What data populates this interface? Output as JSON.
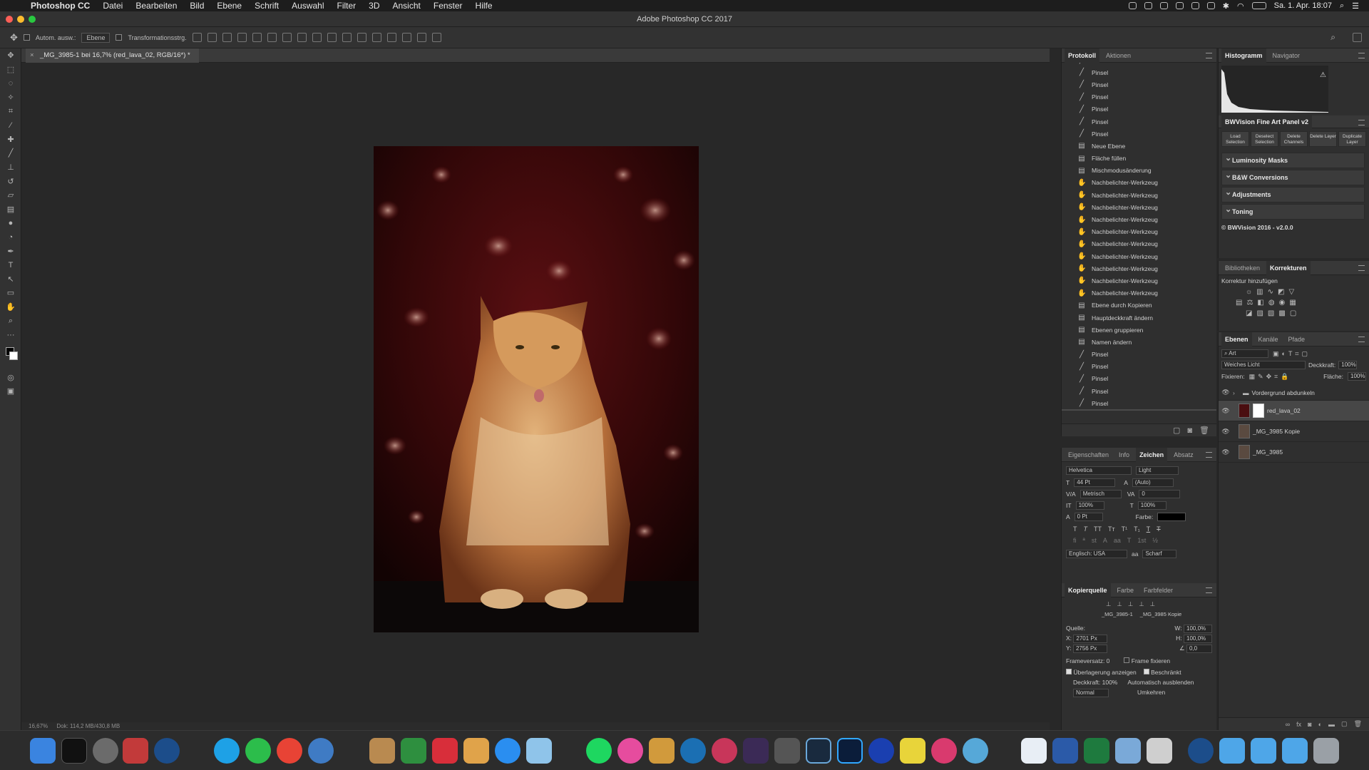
{
  "menubar": {
    "app": "Photoshop CC",
    "items": [
      "Datei",
      "Bearbeiten",
      "Bild",
      "Ebene",
      "Schrift",
      "Auswahl",
      "Filter",
      "3D",
      "Ansicht",
      "Fenster",
      "Hilfe"
    ],
    "clock": "Sa. 1. Apr. 18:07"
  },
  "window": {
    "title": "Adobe Photoshop CC 2017"
  },
  "options": {
    "auto_select": "Autom. ausw.:",
    "auto_select_target": "Ebene",
    "transform": "Transformationsstrg."
  },
  "document": {
    "tab": "_MG_3985-1 bei 16,7% (red_lava_02, RGB/16*) *",
    "status": "16,67%",
    "doc_size": "Dok: 114,2 MB/430,8 MB"
  },
  "protokoll": {
    "tabs": [
      "Protokoll",
      "Aktionen"
    ],
    "items": [
      "Pinsel",
      "Pinsel",
      "Pinsel",
      "Pinsel",
      "Pinsel",
      "Pinsel",
      "Pinsel",
      "Neue Ebene",
      "Fläche füllen",
      "Mischmodusänderung",
      "Nachbelichter-Werkzeug",
      "Nachbelichter-Werkzeug",
      "Nachbelichter-Werkzeug",
      "Nachbelichter-Werkzeug",
      "Nachbelichter-Werkzeug",
      "Nachbelichter-Werkzeug",
      "Nachbelichter-Werkzeug",
      "Nachbelichter-Werkzeug",
      "Nachbelichter-Werkzeug",
      "Nachbelichter-Werkzeug",
      "Ebene durch Kopieren",
      "Hauptdeckkraft ändern",
      "Ebenen gruppieren",
      "Namen ändern",
      "Pinsel",
      "Pinsel",
      "Pinsel",
      "Pinsel",
      "Pinsel",
      "Pinsel"
    ]
  },
  "zeichen": {
    "tabs": [
      "Eigenschaften",
      "Info",
      "Zeichen",
      "Absatz"
    ],
    "font": "Helvetica",
    "style": "Light",
    "size": "44 Pt",
    "leading": "(Auto)",
    "kerning": "Metrisch",
    "tracking": "0",
    "vscale": "100%",
    "hscale": "100%",
    "baseline": "0 Pt",
    "color_label": "Farbe:",
    "language": "Englisch: USA",
    "aa": "Scharf"
  },
  "kopierquelle": {
    "tabs": [
      "Kopierquelle",
      "Farbe",
      "Farbfelder"
    ],
    "src1": "_MG_3985-1",
    "src2": "_MG_3985 Kopie",
    "quelle": "Quelle:",
    "x": "2701 Px",
    "y": "2756 Px",
    "w": "100,0%",
    "h": "100,0%",
    "angle": "0,0",
    "frame_offset": "Frameversatz: 0",
    "frame_fix": "Frame fixieren",
    "overlay": "Überlagerung anzeigen",
    "clipped": "Beschränkt",
    "opacity": "Deckkraft: 100%",
    "autohide": "Automatisch ausblenden",
    "mode": "Normal",
    "invert": "Umkehren"
  },
  "histogram": {
    "tabs": [
      "Histogramm",
      "Navigator"
    ]
  },
  "bwvision": {
    "title": "BWVision Fine Art Panel v2",
    "buttons": [
      "Load Selection",
      "Deselect Selection",
      "Delete Channels",
      "Delete Layer",
      "Duplicate Layer"
    ],
    "sections": [
      "Luminosity Masks",
      "B&W Conversions",
      "Adjustments",
      "Toning"
    ],
    "footer": "© BWVision 2016 - v2.0.0"
  },
  "korrekturen": {
    "tabs": [
      "Bibliotheken",
      "Korrekturen"
    ],
    "label": "Korrektur hinzufügen"
  },
  "ebenen": {
    "tabs": [
      "Ebenen",
      "Kanäle",
      "Pfade"
    ],
    "filter": "Art",
    "blend": "Weiches Licht",
    "opacity_label": "Deckkraft:",
    "opacity": "100%",
    "lock_label": "Fixieren:",
    "fill_label": "Fläche:",
    "fill": "100%",
    "layers": [
      "Vordergrund abdunkeln",
      "red_lava_02",
      "_MG_3985 Kopie",
      "_MG_3985"
    ]
  }
}
